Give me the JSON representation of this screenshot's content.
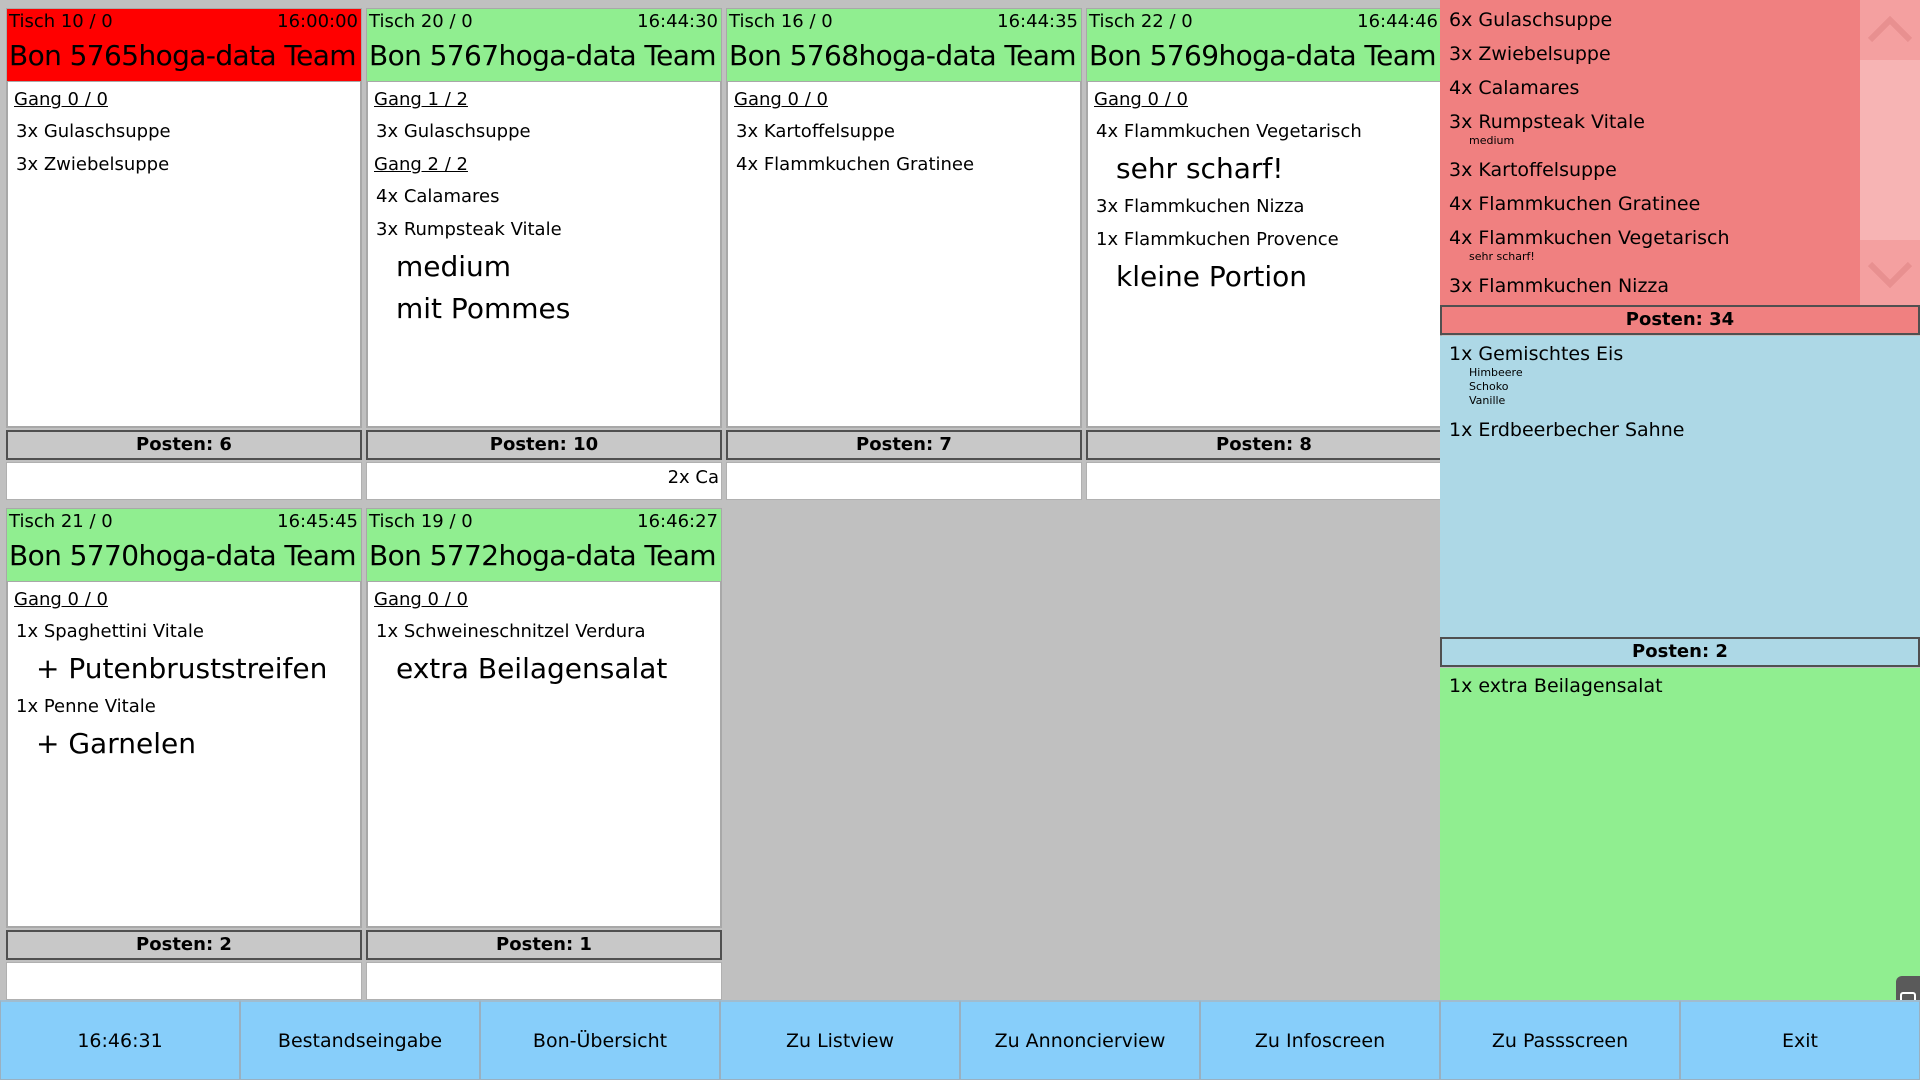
{
  "bons": [
    {
      "table": "Tisch 10 / 0",
      "time": "16:00:00",
      "title": "Bon 5765hoga-data Team",
      "late": true,
      "lines": [
        {
          "type": "gang",
          "text": "Gang 0 / 0"
        },
        {
          "type": "item",
          "text": "3x Gulaschsuppe"
        },
        {
          "type": "item",
          "text": "3x Zwiebelsuppe"
        }
      ],
      "count": "Posten: 6",
      "footer": ""
    },
    {
      "table": "Tisch 20 / 0",
      "time": "16:44:30",
      "title": "Bon 5767hoga-data Team",
      "late": false,
      "lines": [
        {
          "type": "gang",
          "text": "Gang 1 / 2"
        },
        {
          "type": "item",
          "text": "3x Gulaschsuppe"
        },
        {
          "type": "gang",
          "text": "Gang 2 / 2"
        },
        {
          "type": "item",
          "text": "4x Calamares"
        },
        {
          "type": "item",
          "text": "3x Rumpsteak Vitale"
        },
        {
          "type": "mod",
          "text": "medium"
        },
        {
          "type": "mod",
          "text": "mit Pommes"
        }
      ],
      "count": "Posten: 10",
      "footer": "2x Ca"
    },
    {
      "table": "Tisch 16 / 0",
      "time": "16:44:35",
      "title": "Bon 5768hoga-data Team",
      "late": false,
      "lines": [
        {
          "type": "gang",
          "text": "Gang 0 / 0"
        },
        {
          "type": "item",
          "text": "3x Kartoffelsuppe"
        },
        {
          "type": "item",
          "text": "4x Flammkuchen Gratinee"
        }
      ],
      "count": "Posten: 7",
      "footer": ""
    },
    {
      "table": "Tisch 22 / 0",
      "time": "16:44:46",
      "title": "Bon 5769hoga-data Team",
      "late": false,
      "lines": [
        {
          "type": "gang",
          "text": "Gang 0 / 0"
        },
        {
          "type": "item",
          "text": "4x Flammkuchen Vegetarisch"
        },
        {
          "type": "mod",
          "text": "sehr scharf!"
        },
        {
          "type": "item",
          "text": "3x Flammkuchen Nizza"
        },
        {
          "type": "item",
          "text": "1x Flammkuchen Provence"
        },
        {
          "type": "mod",
          "text": "kleine Portion"
        }
      ],
      "count": "Posten: 8",
      "footer": ""
    },
    {
      "table": "Tisch 21 / 0",
      "time": "16:45:45",
      "title": "Bon 5770hoga-data Team",
      "late": false,
      "lines": [
        {
          "type": "gang",
          "text": "Gang 0 / 0"
        },
        {
          "type": "item",
          "text": "1x Spaghettini Vitale"
        },
        {
          "type": "mod",
          "text": "+ Putenbruststreifen"
        },
        {
          "type": "item",
          "text": "1x Penne Vitale"
        },
        {
          "type": "mod",
          "text": "+ Garnelen"
        }
      ],
      "count": "Posten: 2",
      "footer": ""
    },
    {
      "table": "Tisch 19 / 0",
      "time": "16:46:27",
      "title": "Bon 5772hoga-data Team",
      "late": false,
      "lines": [
        {
          "type": "gang",
          "text": "Gang 0 / 0"
        },
        {
          "type": "item",
          "text": "1x Schweineschnitzel Verdura"
        },
        {
          "type": "mod",
          "text": "extra Beilagensalat"
        }
      ],
      "count": "Posten: 1",
      "footer": ""
    }
  ],
  "summary": {
    "red": {
      "items": [
        {
          "text": "6x Gulaschsuppe",
          "subs": []
        },
        {
          "text": "3x Zwiebelsuppe",
          "subs": []
        },
        {
          "text": "4x Calamares",
          "subs": []
        },
        {
          "text": "3x Rumpsteak Vitale",
          "subs": [
            "medium"
          ]
        },
        {
          "text": "3x Kartoffelsuppe",
          "subs": []
        },
        {
          "text": "4x Flammkuchen Gratinee",
          "subs": []
        },
        {
          "text": "4x Flammkuchen Vegetarisch",
          "subs": [
            "sehr scharf!"
          ]
        },
        {
          "text": "3x Flammkuchen Nizza",
          "subs": []
        }
      ],
      "count": "Posten: 34"
    },
    "blue": {
      "items": [
        {
          "text": "1x Gemischtes Eis",
          "subs": [
            "Himbeere",
            "Schoko",
            "Vanille"
          ]
        },
        {
          "text": "1x Erdbeerbecher Sahne",
          "subs": []
        }
      ],
      "count": "Posten: 2"
    },
    "green": {
      "items": [
        {
          "text": "1x extra Beilagensalat",
          "subs": []
        }
      ]
    }
  },
  "bottom_buttons": [
    {
      "label": "16:46:31",
      "name": "clock-button"
    },
    {
      "label": "Bestandseingabe",
      "name": "bestandseingabe-button"
    },
    {
      "label": "Bon-Übersicht",
      "name": "bon-uebersicht-button"
    },
    {
      "label": "Zu Listview",
      "name": "zu-listview-button"
    },
    {
      "label": "Zu Annoncierview",
      "name": "zu-annoncierview-button"
    },
    {
      "label": "Zu Infoscreen",
      "name": "zu-infoscreen-button"
    },
    {
      "label": "Zu Passscreen",
      "name": "zu-passscreen-button"
    },
    {
      "label": "Exit",
      "name": "exit-button"
    }
  ],
  "colors": {
    "bon_ok": "#90ee90",
    "bon_late": "#ff0000",
    "summary_red": "#f08080",
    "summary_blue": "#add8e6",
    "summary_green": "#90ee90",
    "button": "#87cefa"
  }
}
